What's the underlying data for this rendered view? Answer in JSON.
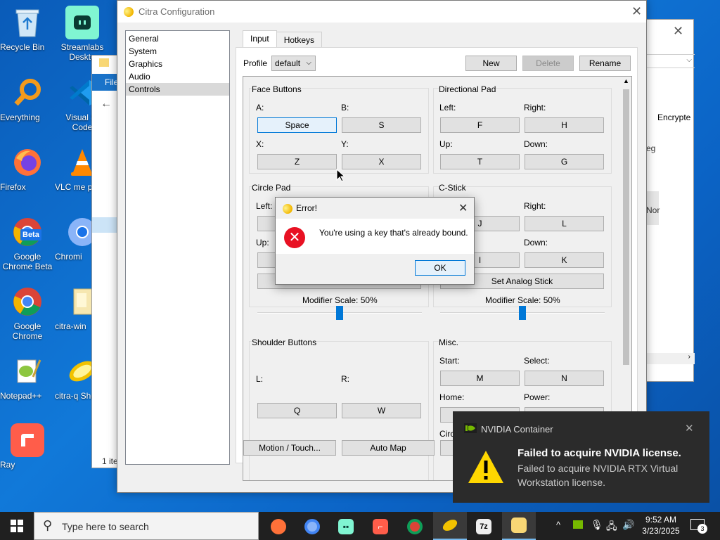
{
  "desktop_icons": [
    {
      "label": "Recycle Bin",
      "icon": "recycle-bin-icon"
    },
    {
      "label": "Streamlabs Deskto",
      "icon": "streamlabs-icon"
    },
    {
      "label": "Everything",
      "icon": "everything-search-icon"
    },
    {
      "label": "Visual St Code",
      "icon": "vscode-icon"
    },
    {
      "label": "Firefox",
      "icon": "firefox-icon"
    },
    {
      "label": "VLC me playe",
      "icon": "vlc-icon"
    },
    {
      "label": "Google Chrome Beta",
      "icon": "chrome-beta-icon"
    },
    {
      "label": "Chromi",
      "icon": "chromium-icon"
    },
    {
      "label": "Google Chrome",
      "icon": "chrome-icon"
    },
    {
      "label": "citra-win",
      "icon": "folder-icon"
    },
    {
      "label": "Notepad++",
      "icon": "notepad-plus-plus-icon"
    },
    {
      "label": "citra-q Shortc",
      "icon": "citra-shortcut-icon"
    },
    {
      "label": "Ray",
      "icon": "ray-icon"
    }
  ],
  "beta_badge": "Beta",
  "background_window": {
    "tab_label": "File",
    "status_text": "1 ite",
    "column_header": "Encrypte",
    "text_fragment_1": "eg",
    "text_fragment_2": "Nor"
  },
  "citra": {
    "title": "Citra Configuration",
    "nav_items": [
      "General",
      "System",
      "Graphics",
      "Audio",
      "Controls"
    ],
    "nav_selected": "Controls",
    "tabs": [
      "Input",
      "Hotkeys"
    ],
    "active_tab": "Input",
    "profile_label": "Profile",
    "profile_value": "default",
    "new_label": "New",
    "delete_label": "Delete",
    "rename_label": "Rename",
    "face_buttons": {
      "title": "Face Buttons",
      "a_label": "A:",
      "a_value": "Space",
      "b_label": "B:",
      "b_value": "S",
      "x_label": "X:",
      "x_value": "Z",
      "y_label": "Y:",
      "y_value": "X"
    },
    "dpad": {
      "title": "Directional Pad",
      "left_label": "Left:",
      "left_value": "F",
      "right_label": "Right:",
      "right_value": "H",
      "up_label": "Up:",
      "up_value": "T",
      "down_label": "Down:",
      "down_value": "G"
    },
    "circle_pad": {
      "title": "Circle Pad",
      "left_label": "Left:",
      "up_label": "Up:",
      "modifier_label": "Modifier Scale: 50%",
      "modifier_value": 0.5
    },
    "c_stick": {
      "title": "C-Stick",
      "right_label": "Right:",
      "right_value": "L",
      "left_value": "J",
      "down_label": "Down:",
      "down_value": "K",
      "up_value": "I",
      "set_analog_label": "Set Analog Stick",
      "modifier_label": "Modifier Scale: 50%",
      "modifier_value": 0.5
    },
    "shoulder": {
      "title": "Shoulder Buttons",
      "l_label": "L:",
      "l_value": "Q",
      "r_label": "R:",
      "r_value": "W"
    },
    "misc": {
      "title": "Misc.",
      "start_label": "Start:",
      "start_value": "M",
      "select_label": "Select:",
      "select_value": "N",
      "home_label": "Home:",
      "power_label": "Power:",
      "circ_label": "Circ"
    },
    "motion_touch_label": "Motion / Touch...",
    "auto_map_label": "Auto Map"
  },
  "error_dialog": {
    "title": "Error!",
    "message": "You're using a key that's already bound.",
    "ok_label": "OK"
  },
  "toast": {
    "app": "NVIDIA Container",
    "title": "Failed to acquire NVIDIA license.",
    "body": "Failed to acquire NVIDIA RTX Virtual Workstation license."
  },
  "taskbar": {
    "search_placeholder": "Type here to search",
    "time": "9:52 AM",
    "date": "3/23/2025",
    "notification_count": "3"
  },
  "colors": {
    "accent": "#0078d7",
    "desktop": "#0b63c5",
    "error": "#e81123",
    "warning": "#ffd700"
  }
}
